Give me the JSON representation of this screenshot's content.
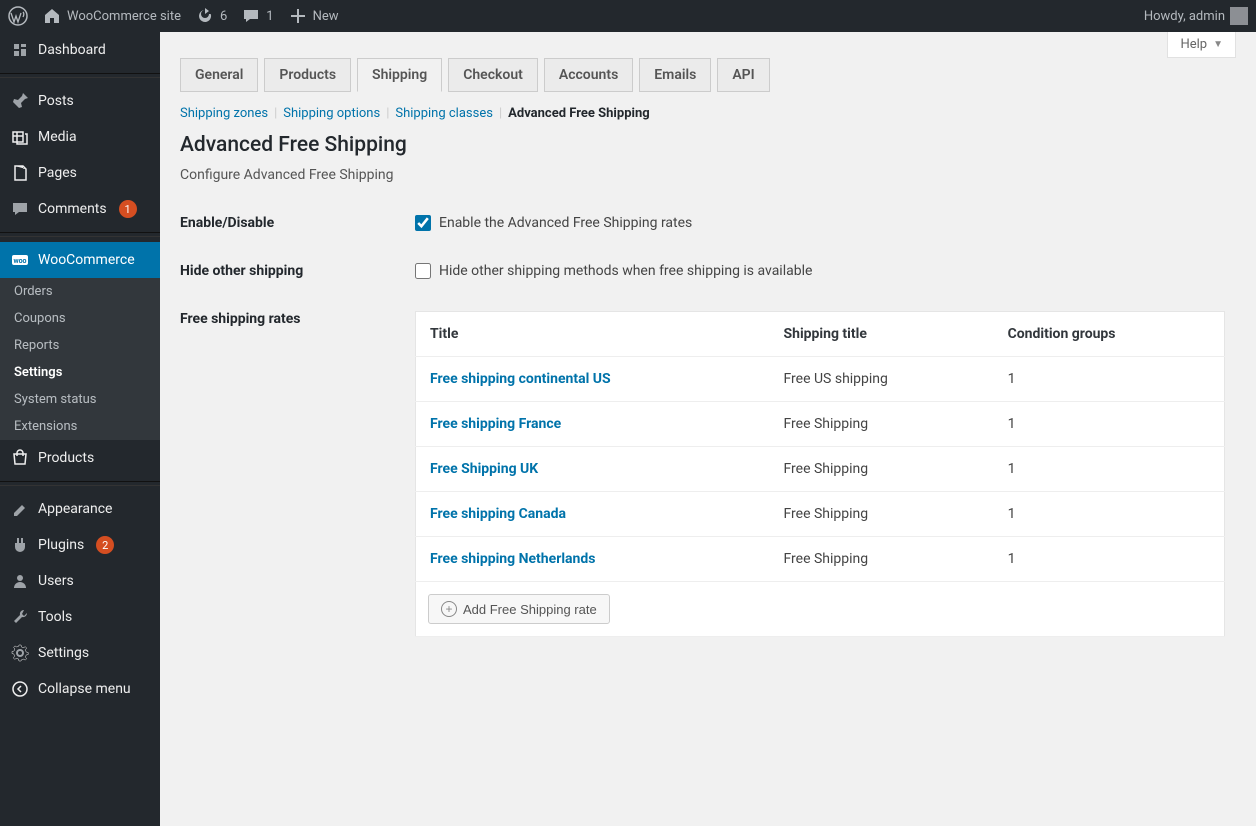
{
  "adminbar": {
    "site_name": "WooCommerce site",
    "updates_count": "6",
    "comments_count": "1",
    "new_label": "New",
    "howdy": "Howdy, admin"
  },
  "sidebar": {
    "items": [
      {
        "label": "Dashboard",
        "icon": "dashboard"
      },
      {
        "label": "Posts",
        "icon": "pin"
      },
      {
        "label": "Media",
        "icon": "media"
      },
      {
        "label": "Pages",
        "icon": "pages"
      },
      {
        "label": "Comments",
        "icon": "comment",
        "badge": "1"
      },
      {
        "label": "WooCommerce",
        "icon": "woo",
        "current": true,
        "submenu": [
          {
            "label": "Orders"
          },
          {
            "label": "Coupons"
          },
          {
            "label": "Reports"
          },
          {
            "label": "Settings",
            "current": true
          },
          {
            "label": "System status"
          },
          {
            "label": "Extensions"
          }
        ]
      },
      {
        "label": "Products",
        "icon": "products"
      },
      {
        "label": "Appearance",
        "icon": "appearance"
      },
      {
        "label": "Plugins",
        "icon": "plugins",
        "badge": "2"
      },
      {
        "label": "Users",
        "icon": "users"
      },
      {
        "label": "Tools",
        "icon": "tools"
      },
      {
        "label": "Settings",
        "icon": "settings"
      },
      {
        "label": "Collapse menu",
        "icon": "collapse"
      }
    ]
  },
  "help_label": "Help",
  "tabs": [
    {
      "label": "General"
    },
    {
      "label": "Products"
    },
    {
      "label": "Shipping",
      "active": true
    },
    {
      "label": "Checkout"
    },
    {
      "label": "Accounts"
    },
    {
      "label": "Emails"
    },
    {
      "label": "API"
    }
  ],
  "subsub": {
    "links": [
      {
        "label": "Shipping zones"
      },
      {
        "label": "Shipping options"
      },
      {
        "label": "Shipping classes"
      }
    ],
    "current": "Advanced Free Shipping"
  },
  "section": {
    "title": "Advanced Free Shipping",
    "description": "Configure Advanced Free Shipping"
  },
  "form": {
    "enable_label": "Enable/Disable",
    "enable_desc": "Enable the Advanced Free Shipping rates",
    "enable_checked": true,
    "hide_label": "Hide other shipping",
    "hide_desc": "Hide other shipping methods when free shipping is available",
    "hide_checked": false,
    "rates_label": "Free shipping rates"
  },
  "rates_table": {
    "headers": {
      "title": "Title",
      "shipping": "Shipping title",
      "groups": "Condition groups"
    },
    "rows": [
      {
        "title": "Free shipping continental US",
        "shipping": "Free US shipping",
        "groups": "1"
      },
      {
        "title": "Free shipping France",
        "shipping": "Free Shipping",
        "groups": "1"
      },
      {
        "title": "Free Shipping UK",
        "shipping": "Free Shipping",
        "groups": "1"
      },
      {
        "title": "Free shipping Canada",
        "shipping": "Free Shipping",
        "groups": "1"
      },
      {
        "title": "Free shipping Netherlands",
        "shipping": "Free Shipping",
        "groups": "1"
      }
    ],
    "add_button": "Add Free Shipping rate"
  }
}
